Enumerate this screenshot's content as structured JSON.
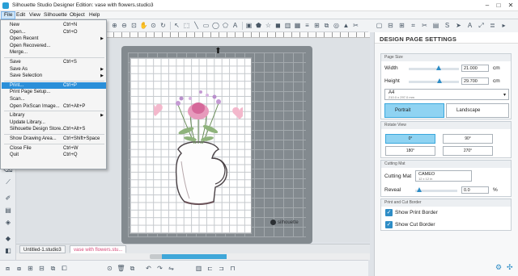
{
  "window": {
    "title": "Silhouette Studio Designer Edition: vase with flowers.studio3",
    "controls": [
      "–",
      "□",
      "✕"
    ]
  },
  "menubar": {
    "items": [
      "File",
      "Edit",
      "View",
      "Silhouette",
      "Object",
      "Help"
    ]
  },
  "file_menu": {
    "items": [
      {
        "label": "New",
        "shortcut": "Ctrl+N"
      },
      {
        "label": "Open...",
        "shortcut": "Ctrl+O"
      },
      {
        "label": "Open Recent",
        "shortcut": "",
        "submenu": true
      },
      {
        "label": "Open Recovered...",
        "shortcut": ""
      },
      {
        "label": "Merge...",
        "shortcut": ""
      },
      {
        "label": "Save",
        "shortcut": "Ctrl+S"
      },
      {
        "label": "Save As",
        "shortcut": "",
        "submenu": true
      },
      {
        "label": "Save Selection",
        "shortcut": "",
        "submenu": true
      },
      {
        "label": "Print...",
        "shortcut": "Ctrl+P",
        "highlighted": true
      },
      {
        "label": "Print Page Setup...",
        "shortcut": ""
      },
      {
        "label": "Scan...",
        "shortcut": ""
      },
      {
        "label": "Open PixScan Image...",
        "shortcut": "Ctrl+Alt+P"
      },
      {
        "label": "Library",
        "shortcut": "",
        "submenu": true
      },
      {
        "label": "Update Library...",
        "shortcut": ""
      },
      {
        "label": "Silhouette Design Store...",
        "shortcut": "Ctrl+Alt+S"
      },
      {
        "label": "Show Drawing Area...",
        "shortcut": "Ctrl+Shift+Space"
      },
      {
        "label": "Close File",
        "shortcut": "Ctrl+W"
      },
      {
        "label": "Quit",
        "shortcut": "Ctrl+Q"
      }
    ]
  },
  "document_tabs": [
    {
      "label": "Untitled-1.studio3",
      "active": false
    },
    {
      "label": "vase with flowers.stu...",
      "active": true
    }
  ],
  "mat_logo": "silhouette",
  "panel": {
    "title": "DESIGN PAGE SETTINGS",
    "page_size": {
      "header": "Page Size",
      "width_label": "Width",
      "width_value": "21.000",
      "height_label": "Height",
      "height_value": "29.700",
      "unit": "cm",
      "width_level": 0.6,
      "height_level": 0.62,
      "preset": "A4",
      "preset_sub": "210.0 x 297.0 mm",
      "portrait": "Portrait",
      "landscape": "Landscape"
    },
    "rotate_view": {
      "header": "Rotate View",
      "options": [
        "0°",
        "90°",
        "180°",
        "270°"
      ],
      "selected": "0°"
    },
    "cutting_mat": {
      "header": "Cutting Mat",
      "label": "Cutting Mat",
      "value": "CAMEO",
      "value_sub": "12 x 12 in",
      "reveal_label": "Reveal",
      "reveal_value": "0.0",
      "reveal_unit": "%"
    },
    "print_cut_border": {
      "header": "Print and Cut Border",
      "show_print_border": "Show Print Border",
      "show_cut_border": "Show Cut Border"
    }
  },
  "colors": {
    "accent": "#2e8dc6",
    "highlight": "#2a8fd9",
    "selection": "#8fd3f2",
    "tab_active_text": "#d64a7a"
  }
}
